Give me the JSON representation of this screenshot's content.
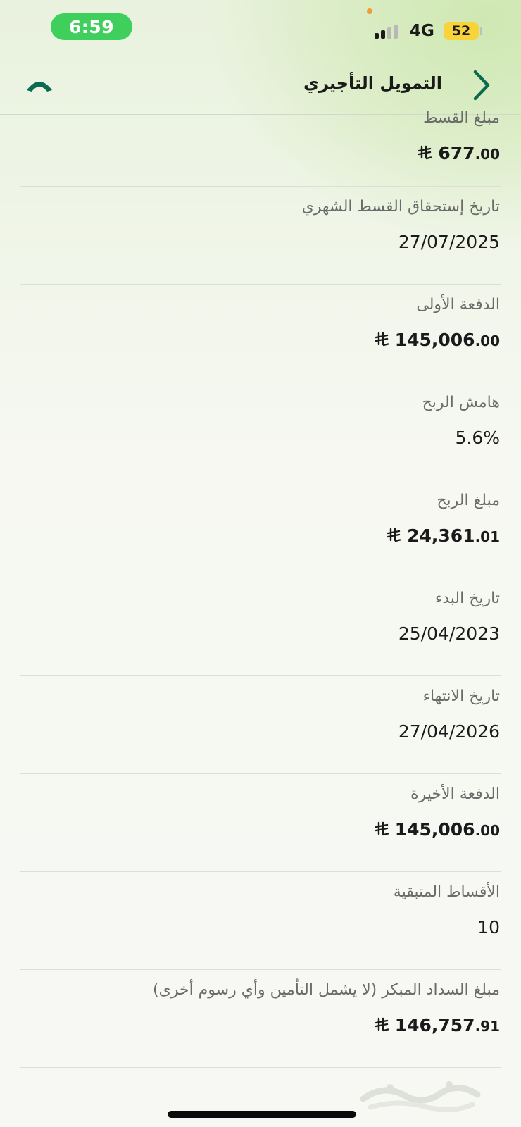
{
  "status_bar": {
    "time": "6:59",
    "network": "4G",
    "battery": "52"
  },
  "nav": {
    "title": "التمويل التأجيري",
    "back_icon": "chevron-right-icon",
    "logo_icon": "crown-arc-icon"
  },
  "colors": {
    "brand_green": "#0b6b4f",
    "status_green": "#3fcf5c",
    "battery_yellow": "#f8d33a"
  },
  "fields": [
    {
      "label": "مبلغ القسط",
      "value_int": "677",
      "value_dec": ".00",
      "currency": true
    },
    {
      "label": "تاريخ إستحقاق القسط الشهري",
      "value": "27/07/2025",
      "currency": false
    },
    {
      "label": "الدفعة الأولى",
      "value_int": "145,006",
      "value_dec": ".00",
      "currency": true
    },
    {
      "label": "هامش الربح",
      "value": "5.6%",
      "currency": false
    },
    {
      "label": "مبلغ الربح",
      "value_int": "24,361",
      "value_dec": ".01",
      "currency": true
    },
    {
      "label": "تاريخ البدء",
      "value": "25/04/2023",
      "currency": false
    },
    {
      "label": "تاريخ الانتهاء",
      "value": "27/04/2026",
      "currency": false
    },
    {
      "label": "الدفعة الأخيرة",
      "value_int": "145,006",
      "value_dec": ".00",
      "currency": true
    },
    {
      "label": "الأقساط المتبقية",
      "value": "10",
      "currency": false
    },
    {
      "label": "مبلغ السداد المبكر (لا يشمل التأمين وأي رسوم أخرى)",
      "value_int": "146,757",
      "value_dec": ".91",
      "currency": true
    }
  ],
  "watermark": "حراج"
}
